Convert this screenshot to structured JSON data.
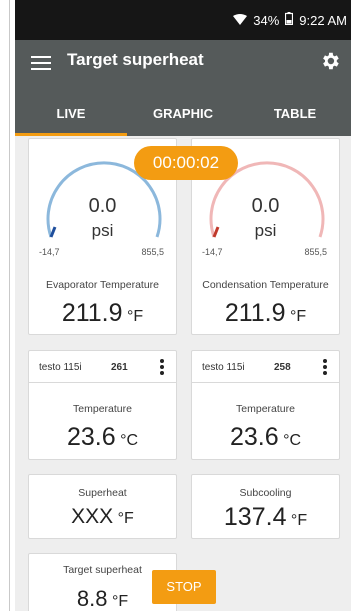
{
  "status_bar": {
    "battery": "34%",
    "time": "9:22 AM"
  },
  "app_bar": {
    "title": "Target superheat"
  },
  "tabs": [
    {
      "label": "LIVE",
      "active": true
    },
    {
      "label": "GRAPHIC",
      "active": false
    },
    {
      "label": "TABLE",
      "active": false
    }
  ],
  "timer": "00:00:02",
  "gauges": {
    "left": {
      "value": "0.0",
      "unit": "psi",
      "min": "-14,7",
      "max": "855,5",
      "label": "Evaporator Temperature",
      "reading": "211.9",
      "reading_unit": "°F",
      "color": "#8cb8dc"
    },
    "right": {
      "value": "0.0",
      "unit": "psi",
      "min": "-14,7",
      "max": "855,5",
      "label": "Condensation Temperature",
      "reading": "211.9",
      "reading_unit": "°F",
      "color": "#f0b7b7"
    }
  },
  "sensors": {
    "left": {
      "name": "testo 115i",
      "id": "261",
      "label": "Temperature",
      "reading": "23.6",
      "unit": "°C"
    },
    "right": {
      "name": "testo 115i",
      "id": "258",
      "label": "Temperature",
      "reading": "23.6",
      "unit": "°C"
    }
  },
  "calc": {
    "superheat": {
      "label": "Superheat",
      "reading": "XXX",
      "unit": "°F"
    },
    "subcooling": {
      "label": "Subcooling",
      "reading": "137.4",
      "unit": "°F"
    }
  },
  "target": {
    "label": "Target superheat",
    "reading": "8.8",
    "unit": "°F"
  },
  "stop_button": "STOP",
  "colors": {
    "accent": "#f39c12",
    "app_bar": "#555a5a",
    "status_bar": "#161616"
  }
}
